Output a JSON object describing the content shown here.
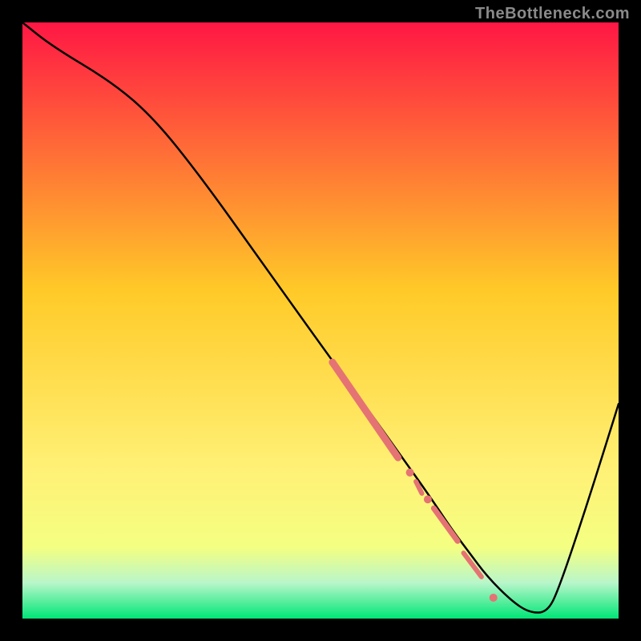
{
  "watermark": {
    "text": "TheBottleneck.com"
  },
  "chart_data": {
    "type": "line",
    "title": "",
    "xlabel": "",
    "ylabel": "",
    "xlim": [
      0,
      100
    ],
    "ylim": [
      0,
      100
    ],
    "grid": false,
    "legend": false,
    "colors": {
      "line": "#000000",
      "marker": "#e57373",
      "gradient_stops": [
        {
          "pos": 0.0,
          "color": "#ff1744"
        },
        {
          "pos": 0.45,
          "color": "#ffca28"
        },
        {
          "pos": 0.75,
          "color": "#fff176"
        },
        {
          "pos": 0.88,
          "color": "#f4ff81"
        },
        {
          "pos": 0.94,
          "color": "#b9f6ca"
        },
        {
          "pos": 1.0,
          "color": "#00e676"
        }
      ]
    },
    "series": [
      {
        "name": "bottleneck-curve",
        "x": [
          0,
          5,
          15,
          22,
          30,
          40,
          50,
          58,
          63,
          68,
          72,
          75,
          78,
          82,
          85,
          88,
          90,
          95,
          100
        ],
        "y": [
          100,
          96,
          90,
          84,
          74,
          60,
          46,
          35,
          28,
          21,
          15,
          11,
          7,
          3,
          1,
          1,
          5,
          20,
          36
        ]
      }
    ],
    "markers": {
      "segments": [
        {
          "x1": 52,
          "y1": 43,
          "x2": 63,
          "y2": 27,
          "width": 9
        },
        {
          "x1": 66,
          "y1": 23,
          "x2": 67,
          "y2": 21,
          "width": 6
        },
        {
          "x1": 69,
          "y1": 18.5,
          "x2": 73,
          "y2": 13,
          "width": 7
        },
        {
          "x1": 74,
          "y1": 11,
          "x2": 77,
          "y2": 7,
          "width": 6
        }
      ],
      "dots": [
        {
          "x": 65,
          "y": 24.5,
          "r": 5
        },
        {
          "x": 68,
          "y": 20,
          "r": 5
        },
        {
          "x": 79,
          "y": 3.5,
          "r": 5
        }
      ]
    }
  }
}
